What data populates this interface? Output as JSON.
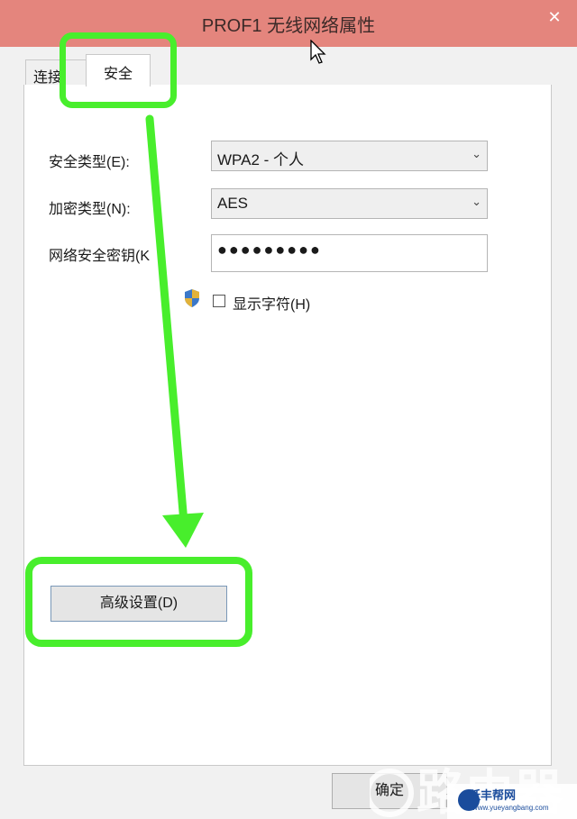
{
  "window": {
    "title": "PROF1 无线网络属性",
    "close_glyph": "✕"
  },
  "tabs": [
    {
      "label": "连接",
      "active": false
    },
    {
      "label": "安全",
      "active": true
    }
  ],
  "form": {
    "security_type": {
      "label": "安全类型(E):",
      "value": "WPA2 - 个人"
    },
    "encryption_type": {
      "label": "加密类型(N):",
      "value": "AES"
    },
    "network_key": {
      "label": "网络安全密钥(K",
      "value": "●●●●●●●●●"
    },
    "show_chars": {
      "label": "显示字符(H)",
      "checked": false
    }
  },
  "buttons": {
    "advanced": "高级设置(D)",
    "ok": "确定"
  },
  "annotations": {
    "highlight_color": "#48ee2c"
  },
  "watermark": {
    "text": "路由器",
    "site_name": "跃丰帮网",
    "url": "www.yueyangbang.com"
  },
  "colors": {
    "titlebar": "#e4857d",
    "dialog_bg": "#f1f1f1"
  }
}
